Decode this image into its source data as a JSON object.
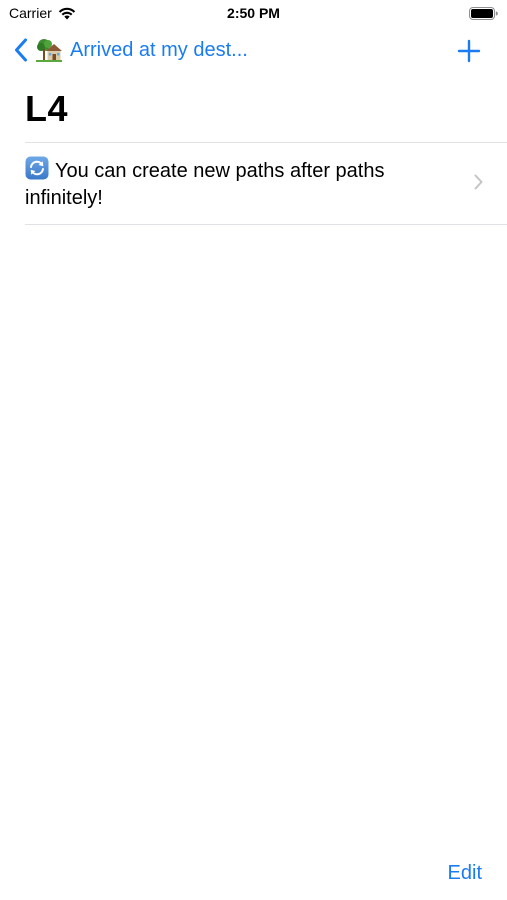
{
  "status_bar": {
    "carrier": "Carrier",
    "time": "2:50 PM"
  },
  "nav": {
    "back_label": "Arrived at my dest...",
    "back_icon": "chevron-left-icon",
    "back_emoji_icon": "house-with-tree-icon",
    "add_icon": "plus-icon"
  },
  "page": {
    "title": "L4"
  },
  "list": {
    "items": [
      {
        "icon": "refresh-icon",
        "text": "You can create new paths after paths infinitely!"
      }
    ]
  },
  "toolbar": {
    "edit_label": "Edit"
  },
  "colors": {
    "accent": "#1a7cf2",
    "separator": "#e1e1e6",
    "chevron": "#c4c4c7"
  }
}
